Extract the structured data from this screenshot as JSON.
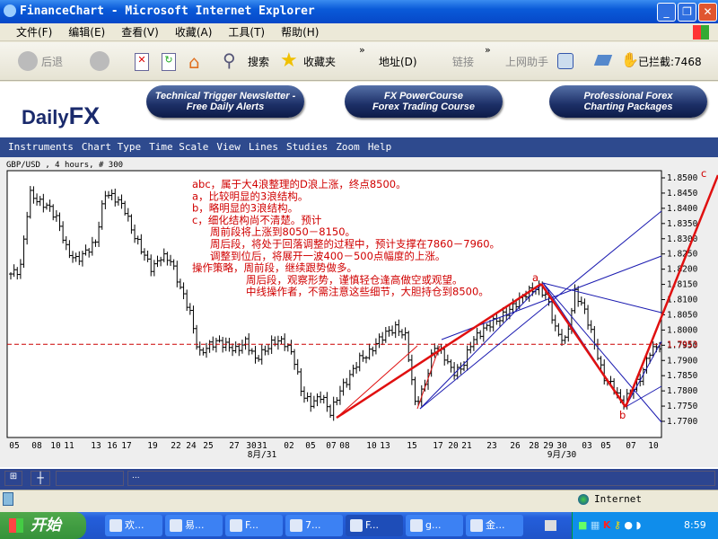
{
  "window": {
    "title": "FinanceChart - Microsoft Internet Explorer"
  },
  "menu": [
    "文件(F)",
    "编辑(E)",
    "查看(V)",
    "收藏(A)",
    "工具(T)",
    "帮助(H)"
  ],
  "toolbar": {
    "back": "后退",
    "search": "搜索",
    "favorites": "收藏夹",
    "address": "地址(D)",
    "links": "链接",
    "helper": "上网助手",
    "blocked": "已拦截:7468",
    "more": "»"
  },
  "banner": {
    "logo_a": "Daily",
    "logo_b": "FX",
    "buttons": [
      {
        "l1": "Technical Trigger Newsletter -",
        "l2": "Free Daily Alerts"
      },
      {
        "l1": "FX PowerCourse",
        "l2": "Forex Trading Course"
      },
      {
        "l1": "Professional Forex",
        "l2": "Charting Packages"
      }
    ]
  },
  "nav": [
    "Instruments",
    "Chart Type",
    "Time Scale",
    "View",
    "Lines",
    "Studies",
    "Zoom",
    "Help"
  ],
  "chart_header": "GBP/USD , 4 hours, # 300",
  "annotations": [
    "abc，属于大4浪整理的D浪上涨，终点8500。",
    "a，比较明显的3浪结构。",
    "b，略明显的3浪结构。",
    "c，细化结构尚不清楚。预计",
    "周前段将上涨到8050－8150。",
    "周后段，将处于回落调整的过程中，预计支撑在7860－7960。",
    "调整到位后，将展开一波400－500点幅度的上涨。",
    "操作策略，周前段，继续跟势做多。",
    "周后段，观察形势，谨慎轻仓逢高做空或观望。",
    "中线操作者，不需注意这些细节，大胆持仓到8500。"
  ],
  "wave_labels": {
    "a": "a",
    "b": "b",
    "c": "c"
  },
  "chart_data": {
    "type": "ohlc",
    "symbol": "GBP/USD",
    "timeframe": "4 hours",
    "ylim": [
      1.768,
      1.852
    ],
    "yticks": [
      "1.8500",
      "1.8450",
      "1.8400",
      "1.8350",
      "1.8300",
      "1.8250",
      "1.8200",
      "1.8150",
      "1.8100",
      "1.8050",
      "1.8000",
      "1.7950",
      "1.7900",
      "1.7850",
      "1.7800",
      "1.7750",
      "1.7700"
    ],
    "current_price": "1.7953",
    "xticks": [
      "05",
      "08",
      "10",
      "11",
      "13",
      "16",
      "17",
      "19",
      "22",
      "24",
      "25",
      "27",
      "30",
      "31",
      "02",
      "05",
      "07",
      "08",
      "10",
      "13",
      "15",
      "17",
      "20",
      "21",
      "23",
      "26",
      "28",
      "29",
      "30",
      "03",
      "05",
      "07",
      "10"
    ],
    "month_labels": [
      "8月/31",
      "9月/30"
    ],
    "closes": [
      1.8184,
      1.8199,
      1.845,
      1.842,
      1.8406,
      1.8361,
      1.8258,
      1.8229,
      1.8258,
      1.8288,
      1.845,
      1.8435,
      1.8406,
      1.8317,
      1.8258,
      1.8199,
      1.8243,
      1.8229,
      1.814,
      1.8066,
      1.7919,
      1.7948,
      1.7963,
      1.7948,
      1.7933,
      1.7963,
      1.7904,
      1.7933,
      1.7963,
      1.7963,
      1.7919,
      1.7786,
      1.7757,
      1.7786,
      1.7727,
      1.7801,
      1.7845,
      1.7904,
      1.7919,
      1.7963,
      1.7993,
      1.8007,
      1.7978,
      1.7757,
      1.7816,
      1.7948,
      1.7919,
      1.786,
      1.7875,
      1.7963,
      1.7993,
      1.8022,
      1.8037,
      1.8066,
      1.8096,
      1.8125,
      1.814,
      1.8111,
      1.7993,
      1.7963,
      1.8125,
      1.8066,
      1.7963,
      1.7845,
      1.7816,
      1.7757,
      1.7801,
      1.7845,
      1.7933,
      1.7948
    ]
  },
  "bottom": {
    "dots": "..."
  },
  "status": {
    "zone": "Internet"
  },
  "taskbar": {
    "start": "开始",
    "tasks": [
      "欢...",
      "易...",
      "F...",
      "7...",
      "F...",
      "g...",
      "金..."
    ],
    "clock": "8:59"
  }
}
